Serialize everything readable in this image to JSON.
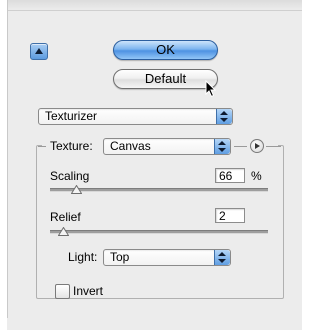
{
  "buttons": {
    "ok_label": "OK",
    "default_label": "Default"
  },
  "filter_select": {
    "value": "Texturizer"
  },
  "texture_group": {
    "texture_label": "Texture:",
    "texture_value": "Canvas",
    "scaling": {
      "label": "Scaling",
      "value": "66",
      "unit": "%",
      "slider_level": 0.12
    },
    "relief": {
      "label": "Relief",
      "value": "2",
      "slider_level": 0.06
    },
    "light": {
      "label": "Light:",
      "value": "Top"
    },
    "invert": {
      "label": "Invert",
      "checked": false
    }
  },
  "colors": {
    "accent": "#5c9be0",
    "window_bg": "#ececec"
  }
}
